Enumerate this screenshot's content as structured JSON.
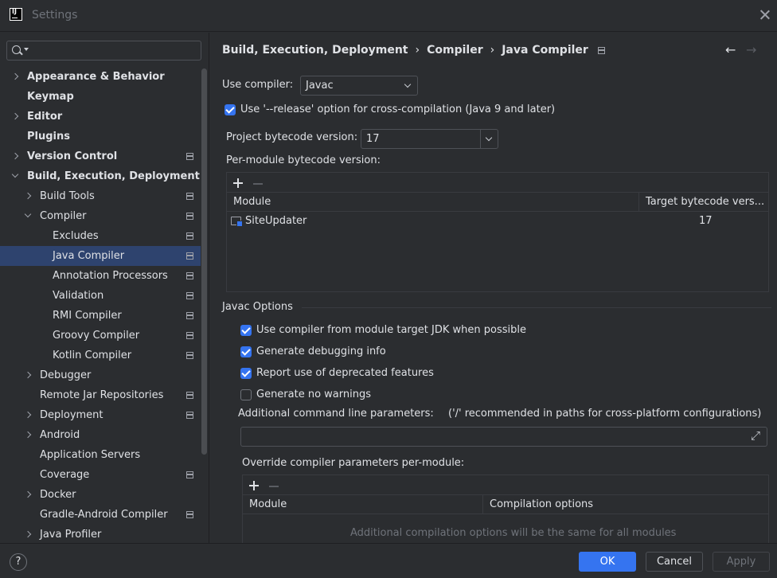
{
  "window": {
    "title": "Settings",
    "logo_text": "IJ"
  },
  "sidebar": {
    "search_placeholder": "",
    "items": [
      {
        "label": "Appearance & Behavior",
        "level": 0,
        "chevron": "right",
        "bold": true,
        "page_icon": false
      },
      {
        "label": "Keymap",
        "level": 0,
        "chevron": "none",
        "bold": true,
        "page_icon": false
      },
      {
        "label": "Editor",
        "level": 0,
        "chevron": "right",
        "bold": true,
        "page_icon": false
      },
      {
        "label": "Plugins",
        "level": 0,
        "chevron": "none",
        "bold": true,
        "page_icon": false
      },
      {
        "label": "Version Control",
        "level": 0,
        "chevron": "right",
        "bold": true,
        "page_icon": true
      },
      {
        "label": "Build, Execution, Deployment",
        "level": 0,
        "chevron": "down",
        "bold": true,
        "page_icon": false
      },
      {
        "label": "Build Tools",
        "level": 1,
        "chevron": "right",
        "bold": false,
        "page_icon": true
      },
      {
        "label": "Compiler",
        "level": 1,
        "chevron": "down",
        "bold": false,
        "page_icon": true
      },
      {
        "label": "Excludes",
        "level": 2,
        "chevron": "none",
        "bold": false,
        "page_icon": true
      },
      {
        "label": "Java Compiler",
        "level": 2,
        "chevron": "none",
        "bold": false,
        "page_icon": true,
        "selected": true
      },
      {
        "label": "Annotation Processors",
        "level": 2,
        "chevron": "none",
        "bold": false,
        "page_icon": true
      },
      {
        "label": "Validation",
        "level": 2,
        "chevron": "none",
        "bold": false,
        "page_icon": true
      },
      {
        "label": "RMI Compiler",
        "level": 2,
        "chevron": "none",
        "bold": false,
        "page_icon": true
      },
      {
        "label": "Groovy Compiler",
        "level": 2,
        "chevron": "none",
        "bold": false,
        "page_icon": true
      },
      {
        "label": "Kotlin Compiler",
        "level": 2,
        "chevron": "none",
        "bold": false,
        "page_icon": true
      },
      {
        "label": "Debugger",
        "level": 1,
        "chevron": "right",
        "bold": false,
        "page_icon": false
      },
      {
        "label": "Remote Jar Repositories",
        "level": 1,
        "chevron": "none",
        "bold": false,
        "page_icon": true
      },
      {
        "label": "Deployment",
        "level": 1,
        "chevron": "right",
        "bold": false,
        "page_icon": true
      },
      {
        "label": "Android",
        "level": 1,
        "chevron": "right",
        "bold": false,
        "page_icon": false
      },
      {
        "label": "Application Servers",
        "level": 1,
        "chevron": "none",
        "bold": false,
        "page_icon": false
      },
      {
        "label": "Coverage",
        "level": 1,
        "chevron": "none",
        "bold": false,
        "page_icon": true
      },
      {
        "label": "Docker",
        "level": 1,
        "chevron": "right",
        "bold": false,
        "page_icon": false
      },
      {
        "label": "Gradle-Android Compiler",
        "level": 1,
        "chevron": "none",
        "bold": false,
        "page_icon": true
      },
      {
        "label": "Java Profiler",
        "level": 1,
        "chevron": "right",
        "bold": false,
        "page_icon": false
      }
    ]
  },
  "breadcrumb": [
    "Build, Execution, Deployment",
    "Compiler",
    "Java Compiler"
  ],
  "nav": {
    "back": "←",
    "forward": "→"
  },
  "compiler": {
    "use_compiler_label": "Use compiler:",
    "use_compiler_value": "Javac",
    "release_option_label": "Use '--release' option for cross-compilation (Java 9 and later)",
    "release_option_checked": true,
    "project_bytecode_label": "Project bytecode version:",
    "project_bytecode_value": "17",
    "per_module_label": "Per-module bytecode version:",
    "per_module_table": {
      "columns": [
        "Module",
        "Target bytecode vers..."
      ],
      "rows": [
        {
          "module": "SiteUpdater",
          "target": "17"
        }
      ]
    }
  },
  "javac_options": {
    "title": "Javac Options",
    "checkboxes": [
      {
        "label": "Use compiler from module target JDK when possible",
        "checked": true
      },
      {
        "label": "Generate debugging info",
        "checked": true
      },
      {
        "label": "Report use of deprecated features",
        "checked": true
      },
      {
        "label": "Generate no warnings",
        "checked": false
      }
    ],
    "additional_params_label": "Additional command line parameters:",
    "additional_params_hint": "('/' recommended in paths for cross-platform configurations)",
    "additional_params_value": "",
    "override_label": "Override compiler parameters per-module:",
    "override_table": {
      "columns": [
        "Module",
        "Compilation options"
      ],
      "empty_text": "Additional compilation options will be the same for all modules"
    }
  },
  "footer": {
    "help": "?",
    "ok": "OK",
    "cancel": "Cancel",
    "apply": "Apply"
  },
  "colors": {
    "accent": "#3574f0",
    "selection": "#2e436e",
    "background": "#2b2d30",
    "text": "#dfe1e5"
  }
}
